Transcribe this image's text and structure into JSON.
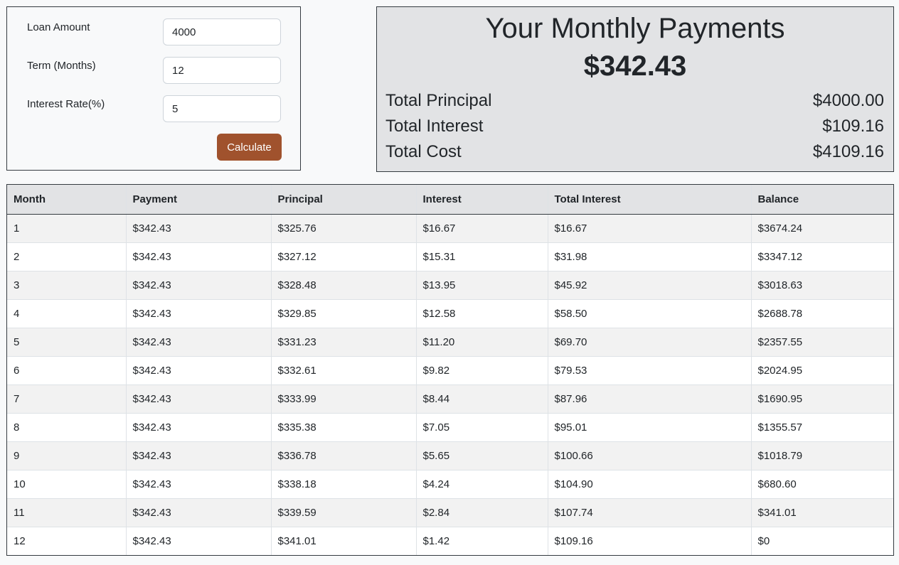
{
  "form": {
    "loan_amount": {
      "label": "Loan Amount",
      "value": "4000"
    },
    "term": {
      "label": "Term (Months)",
      "value": "12"
    },
    "rate": {
      "label": "Interest Rate(%)",
      "value": "5"
    },
    "calculate_label": "Calculate"
  },
  "summary": {
    "title": "Your Monthly Payments",
    "monthly_payment": "$342.43",
    "total_principal": {
      "label": "Total Principal",
      "value": "$4000.00"
    },
    "total_interest": {
      "label": "Total Interest",
      "value": "$109.16"
    },
    "total_cost": {
      "label": "Total Cost",
      "value": "$4109.16"
    }
  },
  "schedule": {
    "columns": [
      "Month",
      "Payment",
      "Principal",
      "Interest",
      "Total Interest",
      "Balance"
    ],
    "rows": [
      [
        "1",
        "$342.43",
        "$325.76",
        "$16.67",
        "$16.67",
        "$3674.24"
      ],
      [
        "2",
        "$342.43",
        "$327.12",
        "$15.31",
        "$31.98",
        "$3347.12"
      ],
      [
        "3",
        "$342.43",
        "$328.48",
        "$13.95",
        "$45.92",
        "$3018.63"
      ],
      [
        "4",
        "$342.43",
        "$329.85",
        "$12.58",
        "$58.50",
        "$2688.78"
      ],
      [
        "5",
        "$342.43",
        "$331.23",
        "$11.20",
        "$69.70",
        "$2357.55"
      ],
      [
        "6",
        "$342.43",
        "$332.61",
        "$9.82",
        "$79.53",
        "$2024.95"
      ],
      [
        "7",
        "$342.43",
        "$333.99",
        "$8.44",
        "$87.96",
        "$1690.95"
      ],
      [
        "8",
        "$342.43",
        "$335.38",
        "$7.05",
        "$95.01",
        "$1355.57"
      ],
      [
        "9",
        "$342.43",
        "$336.78",
        "$5.65",
        "$100.66",
        "$1018.79"
      ],
      [
        "10",
        "$342.43",
        "$338.18",
        "$4.24",
        "$104.90",
        "$680.60"
      ],
      [
        "11",
        "$342.43",
        "$339.59",
        "$2.84",
        "$107.74",
        "$341.01"
      ],
      [
        "12",
        "$342.43",
        "$341.01",
        "$1.42",
        "$109.16",
        "$0"
      ]
    ]
  },
  "colors": {
    "button": "#a0522d",
    "summary_bg": "#e2e3e5",
    "stripe": "#f2f2f2"
  }
}
